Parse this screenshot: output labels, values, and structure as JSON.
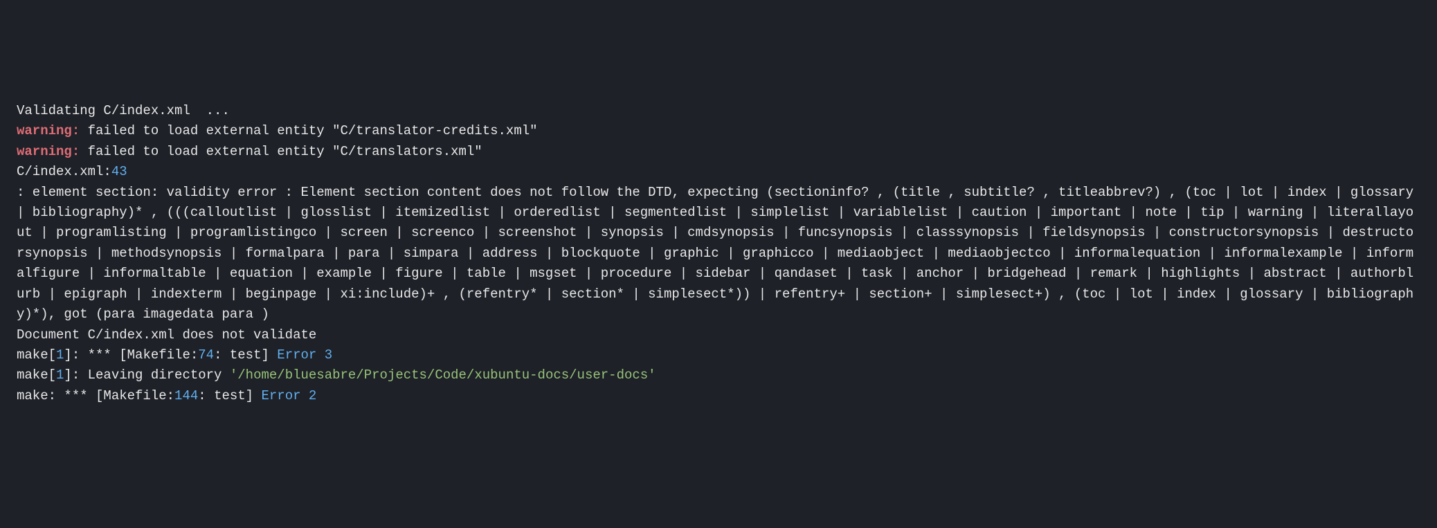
{
  "lines": {
    "l1": "Validating C/index.xml  ...",
    "l2_w": "warning:",
    "l2_r": " failed to load external entity \"C/translator-credits.xml\"",
    "l3_w": "warning:",
    "l3_r": " failed to load external entity \"C/translators.xml\"",
    "l4_a": "C/index.xml:",
    "l4_b": "43",
    "l5": ": element section: validity error : Element section content does not follow the DTD, expecting (sectioninfo? , (title , subtitle? , titleabbrev?) , (toc | lot | index | glossary | bibliography)* , (((calloutlist | glosslist | itemizedlist | orderedlist | segmentedlist | simplelist | variablelist | caution | important | note | tip | warning | literallayout | programlisting | programlistingco | screen | screenco | screenshot | synopsis | cmdsynopsis | funcsynopsis | classsynopsis | fieldsynopsis | constructorsynopsis | destructorsynopsis | methodsynopsis | formalpara | para | simpara | address | blockquote | graphic | graphicco | mediaobject | mediaobjectco | informalequation | informalexample | informalfigure | informaltable | equation | example | figure | table | msgset | procedure | sidebar | qandaset | task | anchor | bridgehead | remark | highlights | abstract | authorblurb | epigraph | indexterm | beginpage | xi:include)+ , (refentry* | section* | simplesect*)) | refentry+ | section+ | simplesect+) , (toc | lot | index | glossary | bibliography)*), got (para imagedata para )",
    "l6": "Document C/index.xml does not validate",
    "l7_a": "make[",
    "l7_b": "1",
    "l7_c": "]: *** [Makefile:",
    "l7_d": "74",
    "l7_e": ": test] ",
    "l7_f": "Error 3",
    "l8_a": "make[",
    "l8_b": "1",
    "l8_c": "]: Leaving directory ",
    "l8_d": "'/home/bluesabre/Projects/Code/xubuntu-docs/user-docs'",
    "l9_a": "make: *** [Makefile:",
    "l9_b": "144",
    "l9_c": ": test] ",
    "l9_d": "Error 2"
  }
}
